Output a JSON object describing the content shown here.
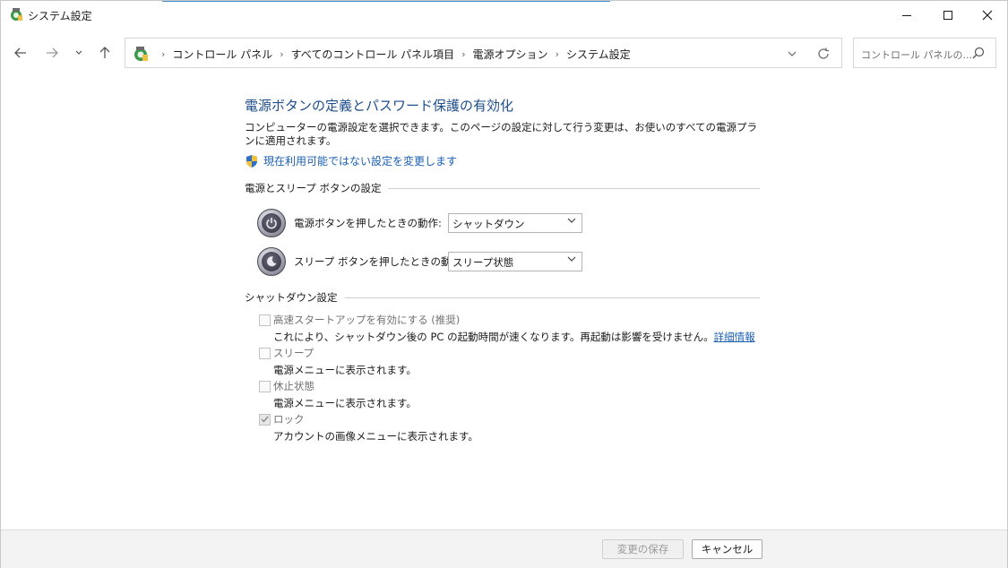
{
  "window": {
    "title": "システム設定"
  },
  "nav": {
    "back_icon": "arrow-left-icon",
    "forward_icon": "arrow-right-icon",
    "recent_icon": "chevron-down-icon",
    "up_icon": "arrow-up-icon"
  },
  "address": {
    "separator": "›",
    "crumbs": [
      "コントロール パネル",
      "すべてのコントロール パネル項目",
      "電源オプション",
      "システム設定"
    ]
  },
  "search": {
    "placeholder": "コントロール パネルの..."
  },
  "content": {
    "title": "電源ボタンの定義とパスワード保護の有効化",
    "description": "コンピューターの電源設定を選択できます。このページの設定に対して行う変更は、お使いのすべての電源プランに適用されます。",
    "change_link": "現在利用可能ではない設定を変更します"
  },
  "buttons_group": {
    "heading": "電源とスリープ ボタンの設定",
    "rows": [
      {
        "label": "電源ボタンを押したときの動作:",
        "value": "シャットダウン"
      },
      {
        "label": "スリープ ボタンを押したときの動作:",
        "value": "スリープ状態"
      }
    ]
  },
  "shutdown_group": {
    "heading": "シャットダウン設定",
    "items": [
      {
        "label": "高速スタートアップを有効にする (推奨)",
        "checked": false,
        "description": "これにより、シャットダウン後の PC の起動時間が速くなります。再起動は影響を受けません。",
        "link": "詳細情報"
      },
      {
        "label": "スリープ",
        "checked": false,
        "description": "電源メニューに表示されます。"
      },
      {
        "label": "休止状態",
        "checked": false,
        "description": "電源メニューに表示されます。"
      },
      {
        "label": "ロック",
        "checked": true,
        "description": "アカウントの画像メニューに表示されます。"
      }
    ]
  },
  "footer": {
    "save_label": "変更の保存",
    "cancel_label": "キャンセル"
  },
  "colors": {
    "title_blue": "#1e4e8c",
    "link_blue": "#1a5fb4"
  }
}
